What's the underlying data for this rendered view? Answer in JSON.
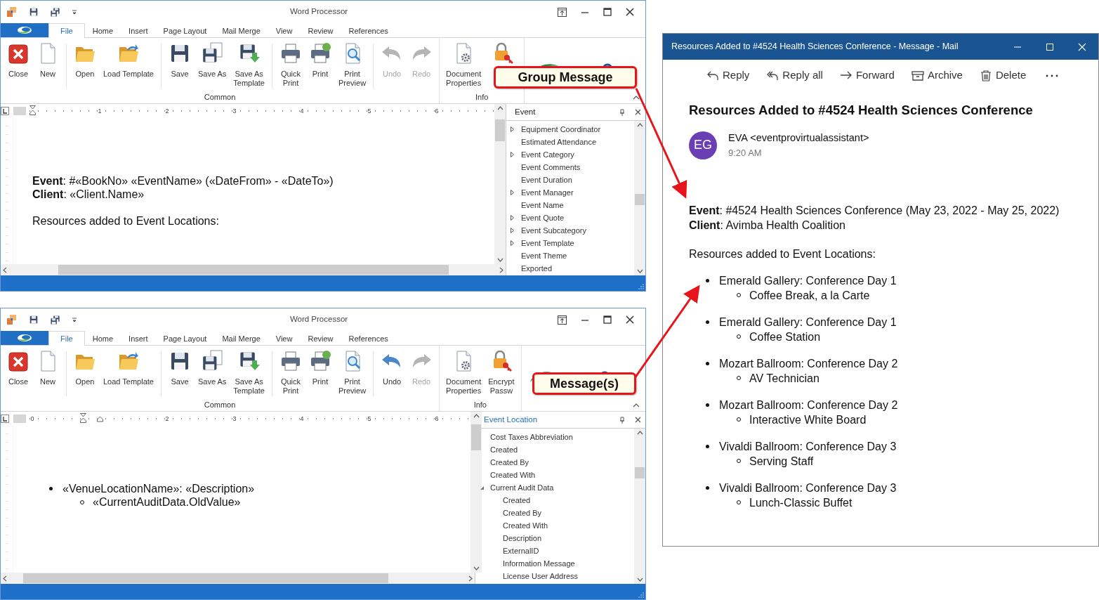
{
  "word_windows": [
    {
      "title": "Word Processor",
      "tabs": [
        {
          "label": "File",
          "selected": true
        },
        {
          "label": "Home",
          "selected": false
        },
        {
          "label": "Insert",
          "selected": false
        },
        {
          "label": "Page Layout",
          "selected": false
        },
        {
          "label": "Mail Merge",
          "selected": false
        },
        {
          "label": "View",
          "selected": false
        },
        {
          "label": "Review",
          "selected": false
        },
        {
          "label": "References",
          "selected": false
        }
      ],
      "ribbon": [
        {
          "label": "Common",
          "sections": [
            [
              {
                "kind": "close",
                "label": "Close",
                "disabled": false
              },
              {
                "kind": "new",
                "label": "New",
                "disabled": false
              }
            ],
            [
              {
                "kind": "open",
                "label": "Open",
                "disabled": false
              },
              {
                "kind": "loadtemplate",
                "label": "Load Template",
                "disabled": false
              }
            ],
            [
              {
                "kind": "save",
                "label": "Save",
                "disabled": false
              },
              {
                "kind": "saveas",
                "label": "Save As",
                "disabled": false
              },
              {
                "kind": "savetemplate",
                "label": "Save As\nTemplate",
                "disabled": false
              }
            ],
            [
              {
                "kind": "quickprint",
                "label": "Quick\nPrint",
                "disabled": false
              },
              {
                "kind": "print",
                "label": "Print",
                "disabled": false
              },
              {
                "kind": "preview",
                "label": "Print\nPreview",
                "disabled": false
              }
            ],
            [
              {
                "kind": "undo",
                "label": "Undo",
                "disabled": true
              },
              {
                "kind": "redo",
                "label": "Redo",
                "disabled": true
              }
            ]
          ]
        },
        {
          "label": "Info",
          "sections": [
            [
              {
                "kind": "docprops",
                "label": "Document\nProperties",
                "disabled": false
              },
              {
                "kind": "encrypt",
                "disabled": false
              }
            ]
          ]
        }
      ],
      "callout": "Group Message",
      "ruler_labels": [
        "1",
        "2",
        "3",
        "4",
        "5",
        "6"
      ],
      "document": [
        {
          "kind": "line",
          "text": "**Event**: #«BookNo» «EventName» («DateFrom» - «DateTo»)"
        },
        {
          "kind": "line",
          "text": "**Client**: «Client.Name»"
        },
        {
          "kind": "blank"
        },
        {
          "kind": "line",
          "text": "Resources added to Event Locations:"
        }
      ],
      "panel": {
        "title": "Event",
        "active": false,
        "items": [
          {
            "kind": "group",
            "label": "Equipment Coordinator",
            "expanded": false
          },
          {
            "kind": "field",
            "label": "Estimated Attendance"
          },
          {
            "kind": "group",
            "label": "Event Category",
            "expanded": false
          },
          {
            "kind": "field",
            "label": "Event Comments"
          },
          {
            "kind": "field",
            "label": "Event Duration"
          },
          {
            "kind": "group",
            "label": "Event Manager",
            "expanded": false
          },
          {
            "kind": "field",
            "label": "Event Name"
          },
          {
            "kind": "group",
            "label": "Event Quote",
            "expanded": false
          },
          {
            "kind": "group",
            "label": "Event Subcategory",
            "expanded": false
          },
          {
            "kind": "group",
            "label": "Event Template",
            "expanded": false
          },
          {
            "kind": "field",
            "label": "Event Theme"
          },
          {
            "kind": "field",
            "label": "Exported"
          }
        ]
      }
    },
    {
      "title": "Word Processor",
      "tabs": [
        {
          "label": "File",
          "selected": true
        },
        {
          "label": "Home",
          "selected": false
        },
        {
          "label": "Insert",
          "selected": false
        },
        {
          "label": "Page Layout",
          "selected": false
        },
        {
          "label": "Mail Merge",
          "selected": false
        },
        {
          "label": "View",
          "selected": false
        },
        {
          "label": "Review",
          "selected": false
        },
        {
          "label": "References",
          "selected": false
        }
      ],
      "ribbon": [
        {
          "label": "Common",
          "sections": [
            [
              {
                "kind": "close",
                "label": "Close",
                "disabled": false
              },
              {
                "kind": "new",
                "label": "New",
                "disabled": false
              }
            ],
            [
              {
                "kind": "open",
                "label": "Open",
                "disabled": false
              },
              {
                "kind": "loadtemplate",
                "label": "Load Template",
                "disabled": false
              }
            ],
            [
              {
                "kind": "save",
                "label": "Save",
                "disabled": false
              },
              {
                "kind": "saveas",
                "label": "Save As",
                "disabled": false
              },
              {
                "kind": "savetemplate",
                "label": "Save As\nTemplate",
                "disabled": false
              }
            ],
            [
              {
                "kind": "quickprint",
                "label": "Quick\nPrint",
                "disabled": false
              },
              {
                "kind": "print",
                "label": "Print",
                "disabled": false
              },
              {
                "kind": "preview",
                "label": "Print\nPreview",
                "disabled": false
              }
            ],
            [
              {
                "kind": "undo",
                "label": "Undo",
                "disabled": false
              },
              {
                "kind": "redo",
                "label": "Redo",
                "disabled": true
              }
            ]
          ]
        },
        {
          "label": "Info",
          "sections": [
            [
              {
                "kind": "docprops",
                "label": "Document\nProperties",
                "disabled": false
              },
              {
                "kind": "encrypt",
                "label": "Encrypt\nPassw",
                "disabled": false
              }
            ]
          ]
        }
      ],
      "callout": "Message(s)",
      "ruler_labels": [
        "0",
        "2",
        "3",
        "4",
        "5",
        "6"
      ],
      "document": [
        {
          "kind": "bullet",
          "text": "«VenueLocationName»: «Description»",
          "children": [
            {
              "kind": "bullet",
              "text": "«CurrentAuditData.OldValue»"
            }
          ]
        }
      ],
      "panel": {
        "title": "Event Location",
        "active": true,
        "items": [
          {
            "kind": "field",
            "label": "Cost Taxes Abbreviation"
          },
          {
            "kind": "field",
            "label": "Created"
          },
          {
            "kind": "field",
            "label": "Created By"
          },
          {
            "kind": "field",
            "label": "Created With"
          },
          {
            "kind": "group",
            "label": "Current Audit Data",
            "expanded": true,
            "children": [
              {
                "kind": "field",
                "label": "Created"
              },
              {
                "kind": "field",
                "label": "Created By"
              },
              {
                "kind": "field",
                "label": "Created With"
              },
              {
                "kind": "field",
                "label": "Description"
              },
              {
                "kind": "field",
                "label": "ExternalID"
              },
              {
                "kind": "field",
                "label": "Information Message"
              },
              {
                "kind": "field",
                "label": "License User Address"
              }
            ]
          }
        ]
      }
    }
  ],
  "mail": {
    "title": "Resources Added to #4524 Health Sciences Conference - Message - Mail",
    "toolbar": [
      {
        "kind": "reply",
        "label": "Reply"
      },
      {
        "kind": "replyall",
        "label": "Reply all"
      },
      {
        "kind": "forward",
        "label": "Forward"
      },
      {
        "kind": "archive",
        "label": "Archive"
      },
      {
        "kind": "delete",
        "label": "Delete"
      },
      {
        "kind": "more"
      }
    ],
    "subject": "Resources Added to #4524 Health Sciences Conference",
    "sender": {
      "initials": "EG",
      "name": "EVA <eventprovirtualassistant>",
      "time": "9:20 AM"
    },
    "body": [
      {
        "kind": "line",
        "text": "**Event**: #4524 Health Sciences Conference (May 23, 2022 - May 25, 2022)"
      },
      {
        "kind": "line",
        "text": "**Client**: Avimba Health Coalition"
      },
      {
        "kind": "blank"
      },
      {
        "kind": "line",
        "text": "Resources added to Event Locations:"
      },
      {
        "kind": "bullet",
        "text": "Emerald Gallery: Conference Day 1",
        "children": [
          {
            "kind": "bullet",
            "text": "Coffee Break, a la Carte"
          }
        ]
      },
      {
        "kind": "bullet",
        "text": "Emerald Gallery: Conference Day 1",
        "children": [
          {
            "kind": "bullet",
            "text": "Coffee Station"
          }
        ]
      },
      {
        "kind": "bullet",
        "text": "Mozart Ballroom: Conference Day 2",
        "children": [
          {
            "kind": "bullet",
            "text": "AV Technician"
          }
        ]
      },
      {
        "kind": "bullet",
        "text": "Mozart Ballroom: Conference Day 2",
        "children": [
          {
            "kind": "bullet",
            "text": "Interactive White Board"
          }
        ]
      },
      {
        "kind": "bullet",
        "text": "Vivaldi Ballroom: Conference Day 3",
        "children": [
          {
            "kind": "bullet",
            "text": "Serving Staff"
          }
        ]
      },
      {
        "kind": "bullet",
        "text": "Vivaldi Ballroom: Conference Day 3",
        "children": [
          {
            "kind": "bullet",
            "text": "Lunch-Classic Buffet"
          }
        ]
      }
    ]
  }
}
